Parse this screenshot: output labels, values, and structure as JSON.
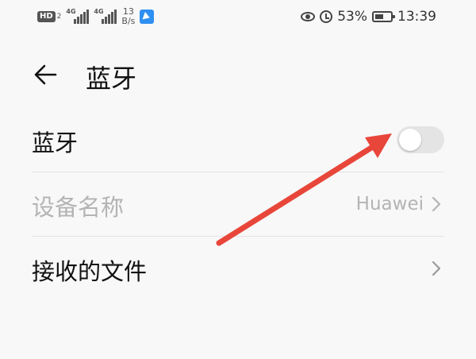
{
  "status_bar": {
    "hd_label": "HD",
    "hd_sub": "2",
    "sim1_label": "4G",
    "sim2_label": "4G",
    "speed_value": "13",
    "speed_unit": "B/s",
    "battery_percent": "53%",
    "battery_level": 0.53,
    "time": "13:39"
  },
  "header": {
    "title": "蓝牙"
  },
  "settings": {
    "bluetooth_label": "蓝牙",
    "bluetooth_enabled": false,
    "device_name_label": "设备名称",
    "device_name_value": "Huawei",
    "received_files_label": "接收的文件"
  },
  "colors": {
    "annotation_arrow": "#e8463a",
    "toggle_off": "#e4e4e4",
    "disabled_text": "#b4b4b4"
  },
  "icons": [
    "back-arrow-icon",
    "chevron-right-icon",
    "eye-icon",
    "alarm-icon",
    "battery-icon",
    "signal-icon",
    "app-icon"
  ]
}
